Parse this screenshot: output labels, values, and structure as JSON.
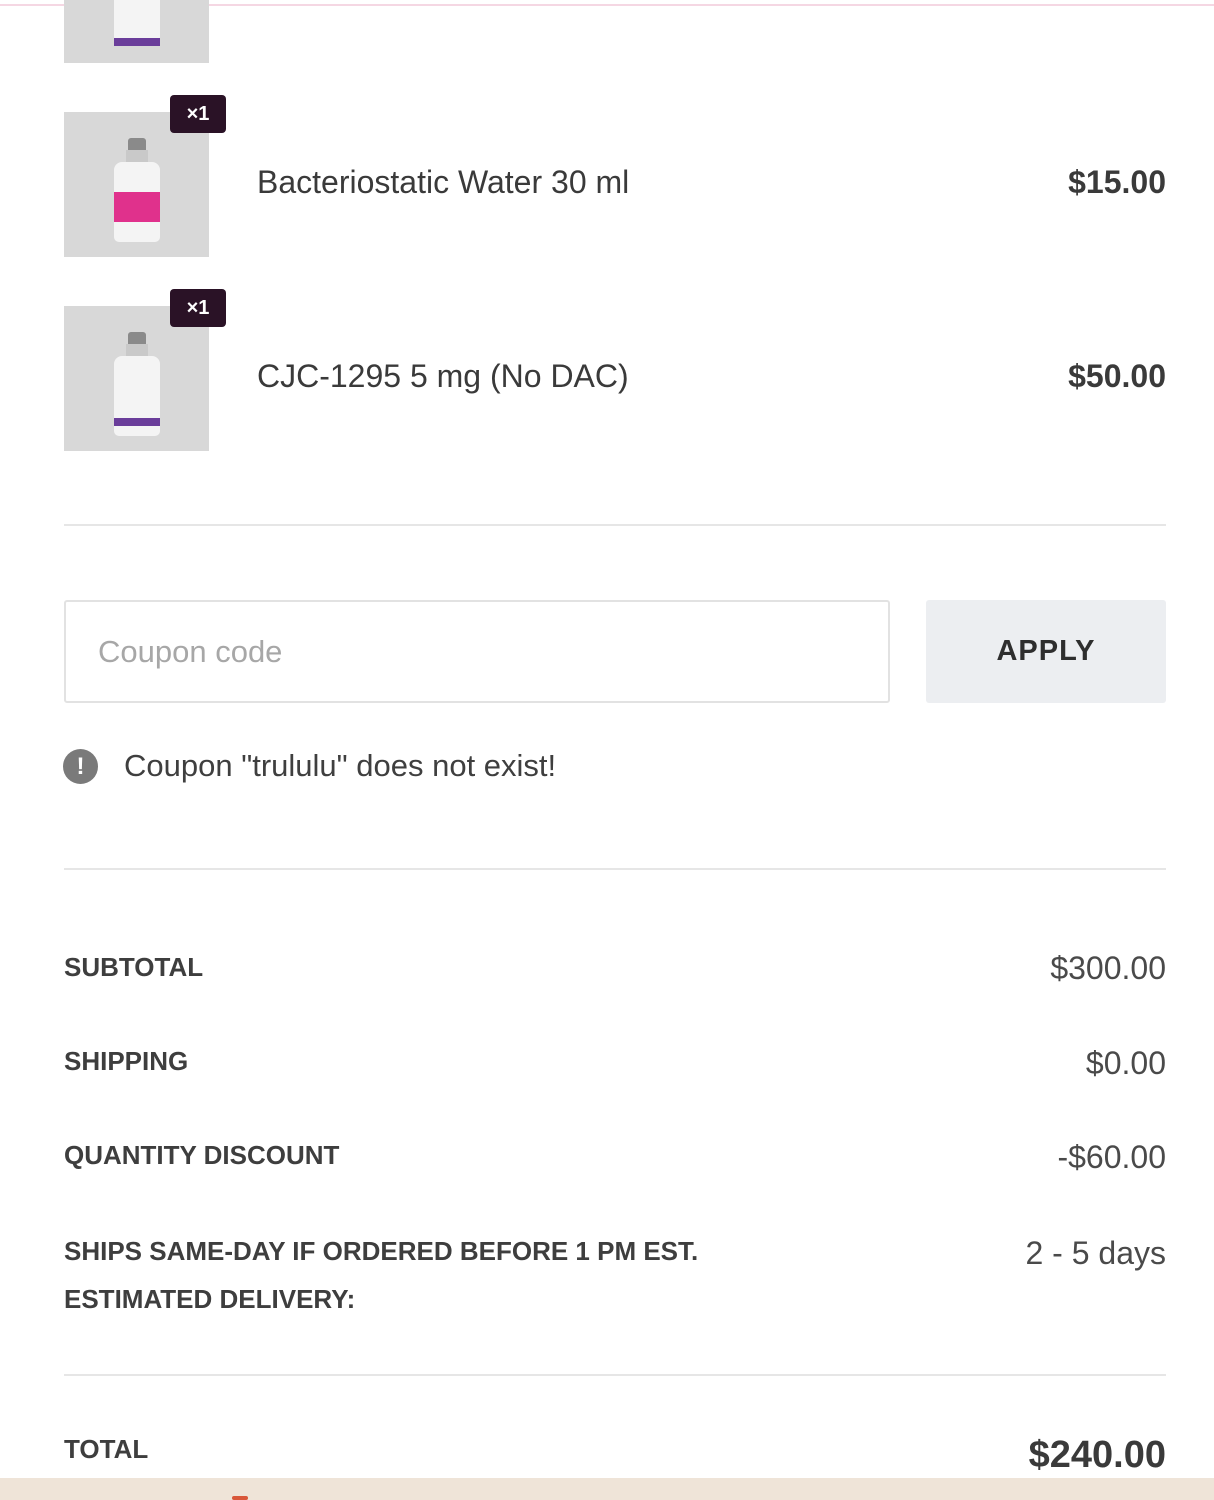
{
  "cart": {
    "items": [
      {
        "name": "Bacteriostatic Water 30 ml",
        "price": "$15.00",
        "quantity_badge": "×1",
        "image_icon": "vial-icon",
        "label_color": "#e0318c"
      },
      {
        "name": "CJC-1295 5 mg (No DAC)",
        "price": "$50.00",
        "quantity_badge": "×1",
        "image_icon": "vial-icon",
        "label_color": "#6a3d9a"
      }
    ]
  },
  "coupon": {
    "placeholder": "Coupon code",
    "value": "",
    "apply_label": "APPLY",
    "error_message": "Coupon \"trululu\" does not exist!",
    "error_icon": "exclamation-circle-icon"
  },
  "summary": {
    "subtotal_label": "SUBTOTAL",
    "subtotal_value": "$300.00",
    "shipping_label": "SHIPPING",
    "shipping_value": "$0.00",
    "discount_label": "QUANTITY DISCOUNT",
    "discount_value": "-$60.00",
    "ships_label_line1": "SHIPS SAME-DAY IF ORDERED BEFORE 1 PM EST.",
    "ships_label_line2": "ESTIMATED DELIVERY:",
    "ships_value": "2 - 5 days",
    "total_label": "TOTAL",
    "total_value": "$240.00"
  },
  "colors": {
    "badge_bg": "#2a1226",
    "apply_bg": "#eceef1",
    "divider": "#e6e6e6"
  }
}
